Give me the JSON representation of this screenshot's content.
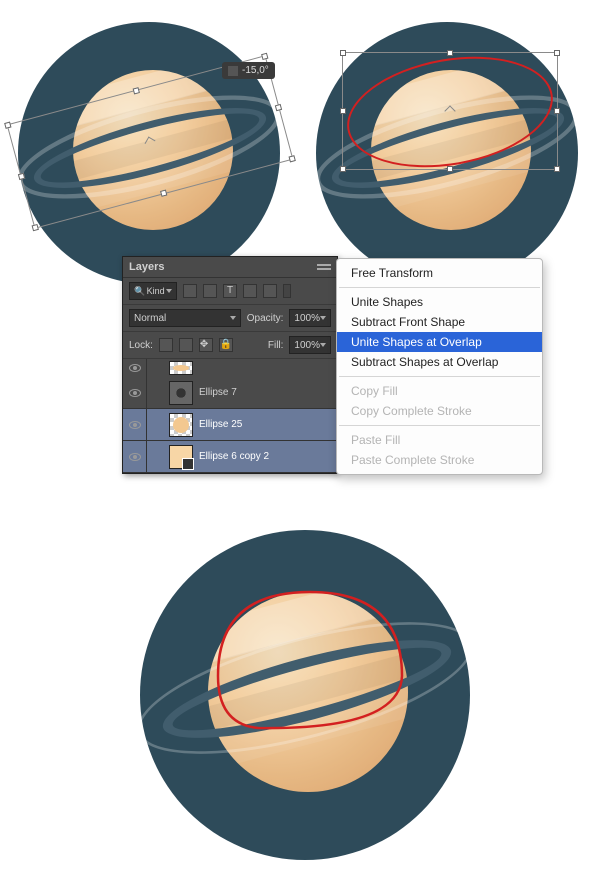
{
  "angle_tooltip": "-15,0°",
  "layers_panel": {
    "title": "Layers",
    "filter_label": "Kind",
    "blend_mode": "Normal",
    "opacity_label": "Opacity:",
    "opacity_value": "100%",
    "lock_label": "Lock:",
    "fill_label": "Fill:",
    "fill_value": "100%",
    "layers": {
      "l1": "Ellipse 7",
      "l2": "Ellipse 25",
      "l3": "Ellipse 6 copy 2"
    }
  },
  "context_menu": {
    "free_transform": "Free Transform",
    "unite_shapes": "Unite Shapes",
    "subtract_front": "Subtract Front Shape",
    "unite_overlap": "Unite Shapes at Overlap",
    "subtract_overlap": "Subtract Shapes at Overlap",
    "copy_fill": "Copy Fill",
    "copy_stroke": "Copy Complete Stroke",
    "paste_fill": "Paste Fill",
    "paste_stroke": "Paste Complete Stroke"
  }
}
